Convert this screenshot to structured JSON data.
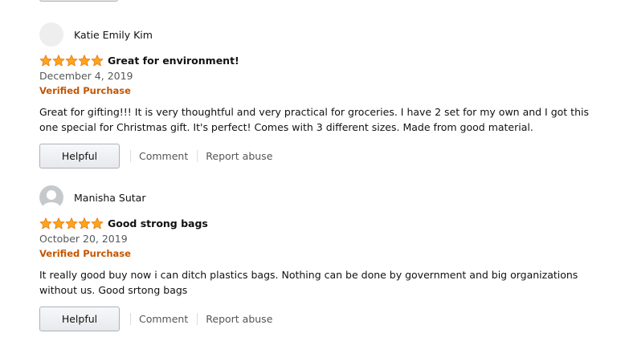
{
  "colors": {
    "star": "#ffa41c",
    "verified": "#c45500",
    "date": "#565959",
    "link": "#555555"
  },
  "reviews": [
    {
      "avatar": "blank-avatar",
      "profile_name": "Katie Emily Kim",
      "rating": 5,
      "title": "Great for environment!",
      "date": "December 4, 2019",
      "verified": "Verified Purchase",
      "body": "Great for gifting!!! It is very thoughtful and very practical for groceries. I have 2 set for my own and I got this one special for Christmas gift. It's perfect! Comes with 3 different sizes. Made from good material.",
      "helpful_label": "Helpful",
      "comment_label": "Comment",
      "report_label": "Report abuse"
    },
    {
      "avatar": "default-user-avatar",
      "profile_name": "Manisha Sutar",
      "rating": 5,
      "title": "Good strong bags",
      "date": "October 20, 2019",
      "verified": "Verified Purchase",
      "body": "It really good buy now i can ditch plastics bags. Nothing can be done by government and big organizations without us. Good srtong bags",
      "helpful_label": "Helpful",
      "comment_label": "Comment",
      "report_label": "Report abuse"
    }
  ]
}
